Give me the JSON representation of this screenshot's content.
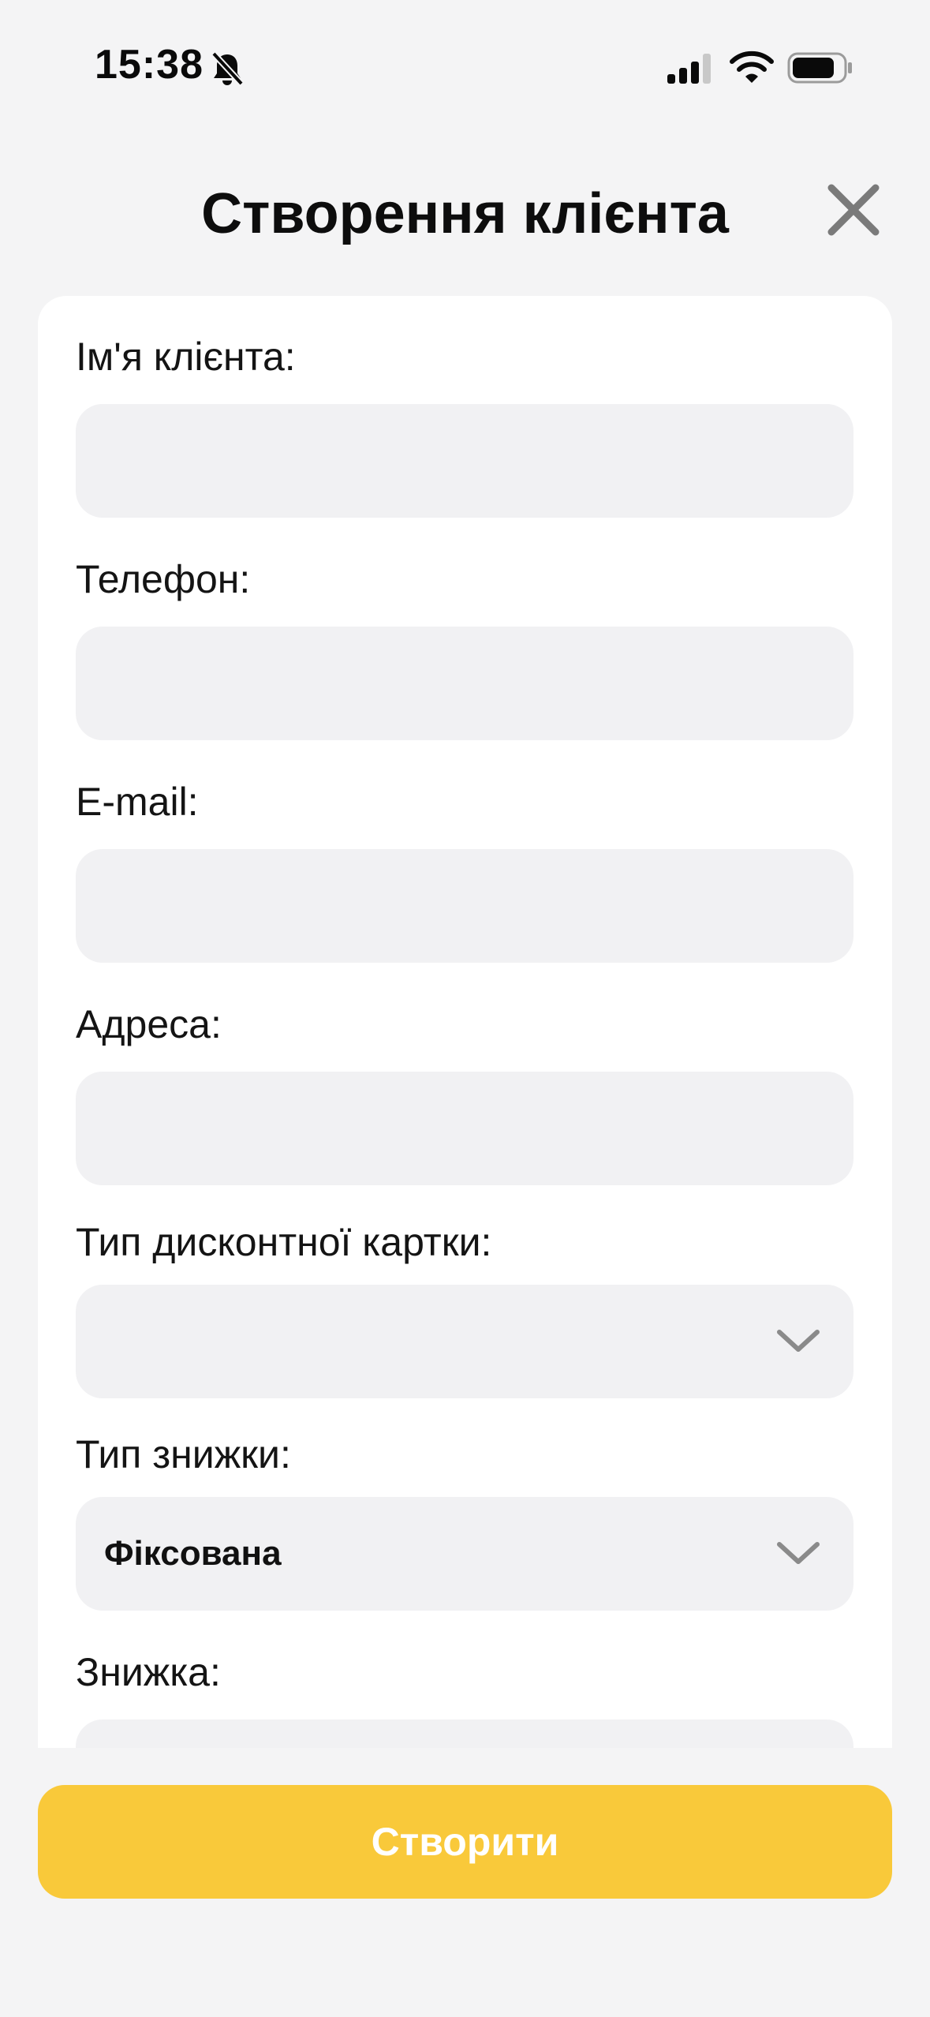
{
  "status_bar": {
    "time": "15:38",
    "icons": [
      "bell-slash-icon",
      "cellular-signal-icon",
      "wifi-icon",
      "battery-icon"
    ]
  },
  "header": {
    "title": "Створення клієнта",
    "close_icon": "close-icon"
  },
  "form": {
    "name": {
      "label": "Ім'я клієнта:",
      "value": ""
    },
    "phone": {
      "label": "Телефон:",
      "value": ""
    },
    "email": {
      "label": "E-mail:",
      "value": ""
    },
    "address": {
      "label": "Адреса:",
      "value": ""
    },
    "card_type": {
      "label": "Тип дисконтної картки:",
      "value": ""
    },
    "discount_type": {
      "label": "Тип знижки:",
      "value": "Фіксована"
    },
    "discount": {
      "label": "Знижка:",
      "value": ""
    }
  },
  "actions": {
    "create_label": "Створити"
  },
  "colors": {
    "accent": "#f9c93a",
    "background": "#f4f4f5",
    "field_bg": "#f1f1f3",
    "card_bg": "#ffffff",
    "icon_gray": "#7a7a7a"
  }
}
